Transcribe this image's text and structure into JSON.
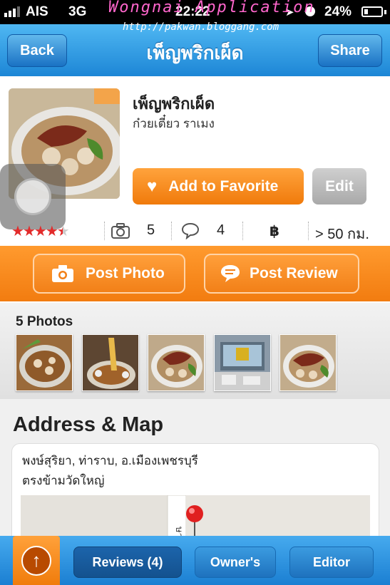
{
  "status_bar": {
    "carrier": "AIS",
    "network": "3G",
    "time": "22:22",
    "battery_percent": "24%",
    "battery_level": 0.24,
    "watermark_title": "Wongnai Application",
    "watermark_url": "http://pakwan.bloggang.com"
  },
  "navbar": {
    "back_label": "Back",
    "title": "เพ็ญพริกเผ็ด",
    "share_label": "Share"
  },
  "restaurant": {
    "name": "เพ็ญพริกเผ็ด",
    "category": "ก๋วยเตี๋ยว ราเมง",
    "favorite_label": "Add to Favorite",
    "edit_label": "Edit",
    "rating": 4.5,
    "photo_count": "5",
    "review_count": "4",
    "price_symbol": "฿",
    "distance": "> 50 กม."
  },
  "actions": {
    "post_photo_label": "Post Photo",
    "post_review_label": "Post Review"
  },
  "photos": {
    "label": "5 Photos",
    "items": [
      "noodle-bowl-1",
      "noodle-lift",
      "noodle-bowl-2",
      "food-stall",
      "noodle-bowl-3"
    ]
  },
  "address": {
    "heading": "Address & Map",
    "line1": "พงษ์สุริยา, ท่าราบ, อ.เมืองเพชรบุรี",
    "line2": "ตรงข้ามวัดใหญ่",
    "map_street_label": "ษาใจ"
  },
  "tabbar": {
    "reviews_label": "Reviews (4)",
    "owners_label": "Owner's",
    "editor_label": "Editor"
  },
  "colors": {
    "nav_blue": "#2a93e0",
    "accent_orange": "#f5860f",
    "star_red": "#e22b2b"
  }
}
